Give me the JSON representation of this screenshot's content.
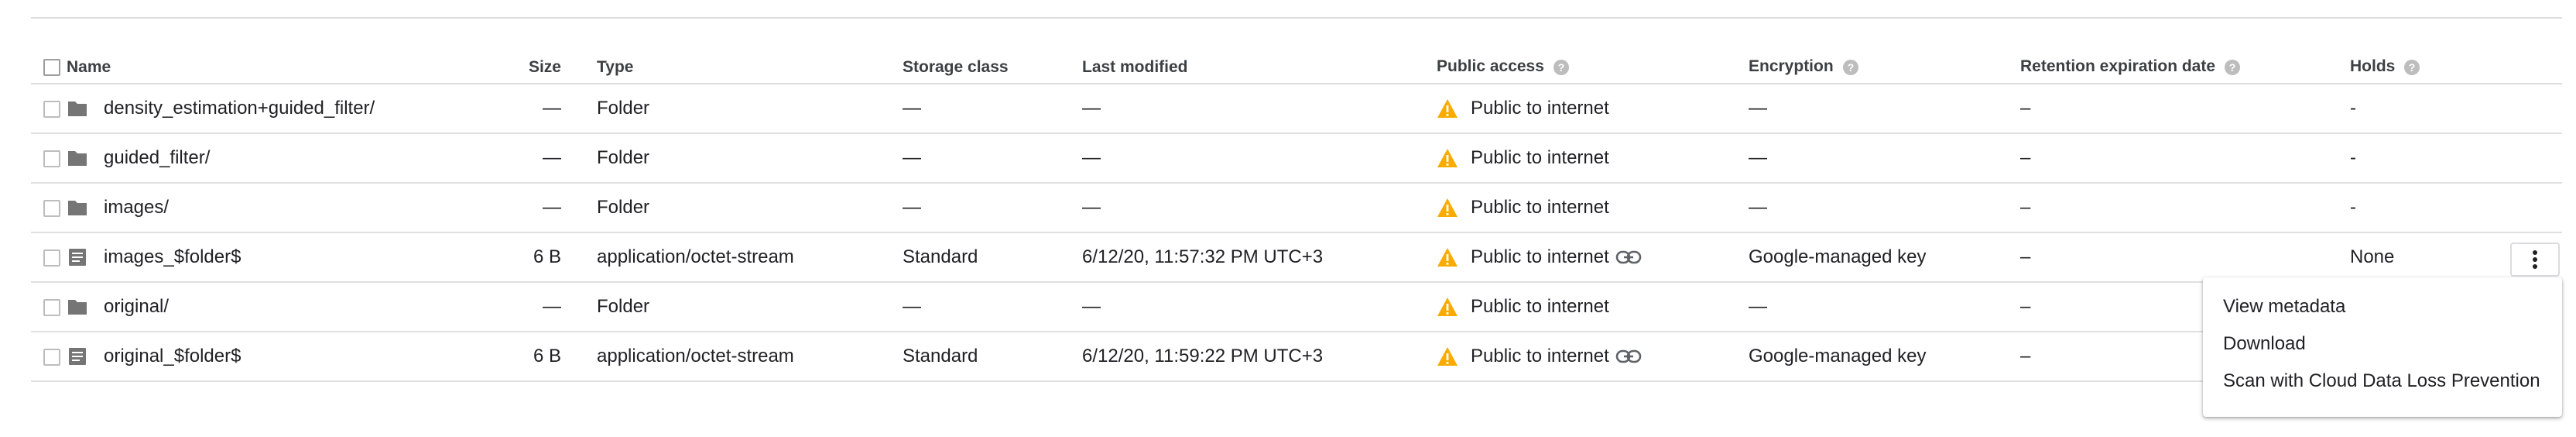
{
  "columns": {
    "name": "Name",
    "size": "Size",
    "type": "Type",
    "storage_class": "Storage class",
    "last_modified": "Last modified",
    "public_access": "Public access",
    "encryption": "Encryption",
    "retention": "Retention expiration date",
    "holds": "Holds"
  },
  "rows": [
    {
      "name": "density_estimation+guided_filter/",
      "kind": "folder",
      "size": "—",
      "type": "Folder",
      "storage_class": "—",
      "last_modified": "—",
      "public_access": "Public to internet",
      "has_link": false,
      "encryption": "—",
      "retention": "–",
      "holds": "-"
    },
    {
      "name": "guided_filter/",
      "kind": "folder",
      "size": "—",
      "type": "Folder",
      "storage_class": "—",
      "last_modified": "—",
      "public_access": "Public to internet",
      "has_link": false,
      "encryption": "—",
      "retention": "–",
      "holds": "-"
    },
    {
      "name": "images/",
      "kind": "folder",
      "size": "—",
      "type": "Folder",
      "storage_class": "—",
      "last_modified": "—",
      "public_access": "Public to internet",
      "has_link": false,
      "encryption": "—",
      "retention": "–",
      "holds": "-"
    },
    {
      "name": "images_$folder$",
      "kind": "file",
      "size": "6 B",
      "type": "application/octet-stream",
      "storage_class": "Standard",
      "last_modified": "6/12/20, 11:57:32 PM UTC+3",
      "public_access": "Public to internet",
      "has_link": true,
      "encryption": "Google-managed key",
      "retention": "–",
      "holds": "None"
    },
    {
      "name": "original/",
      "kind": "folder",
      "size": "—",
      "type": "Folder",
      "storage_class": "—",
      "last_modified": "—",
      "public_access": "Public to internet",
      "has_link": false,
      "encryption": "—",
      "retention": "–",
      "holds": ""
    },
    {
      "name": "original_$folder$",
      "kind": "file",
      "size": "6 B",
      "type": "application/octet-stream",
      "storage_class": "Standard",
      "last_modified": "6/12/20, 11:59:22 PM UTC+3",
      "public_access": "Public to internet",
      "has_link": true,
      "encryption": "Google-managed key",
      "retention": "–",
      "holds": ""
    }
  ],
  "context_menu": {
    "items": [
      "View metadata",
      "Download",
      "Scan with Cloud Data Loss Prevention"
    ]
  },
  "colors": {
    "warning": "#f9ab00",
    "icon_gray": "#757575",
    "border": "#dadce0"
  },
  "icons": {
    "folder": "folder-icon",
    "file": "file-icon",
    "warning": "warning-icon",
    "link": "link-icon",
    "help": "help-icon",
    "more": "more-vert-icon"
  }
}
